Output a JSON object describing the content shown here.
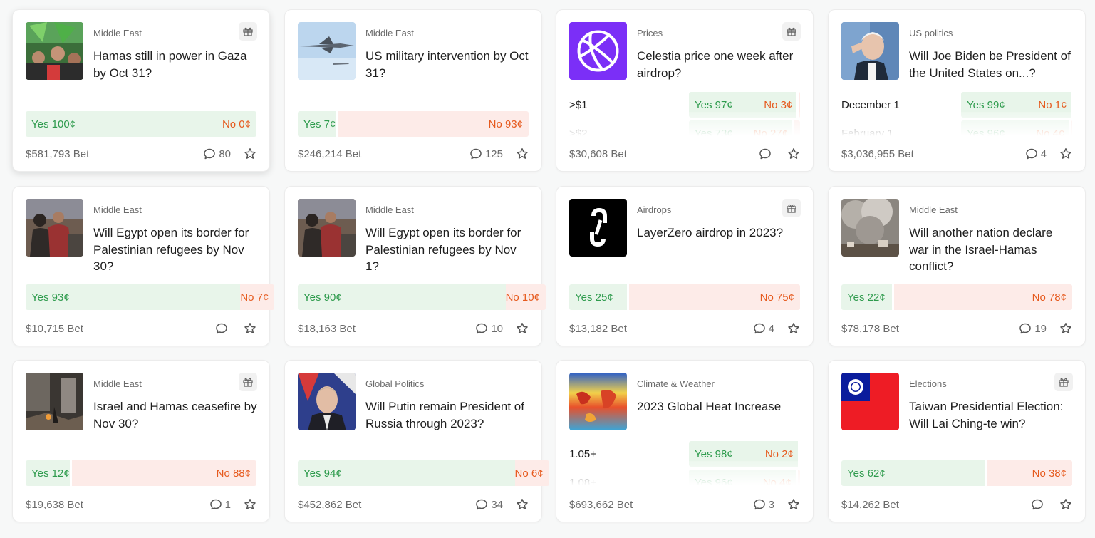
{
  "colors": {
    "yes": "#2e9b4d",
    "no": "#e65a1e",
    "yes_bg": "#e8f5ea",
    "no_bg": "#fdebe8"
  },
  "icons": {
    "gift": "gift-icon",
    "comment": "comment-icon",
    "star": "star-icon"
  },
  "cards": [
    {
      "category": "Middle East",
      "title": "Hamas still in power in Gaza by Oct 31?",
      "yes_label": "Yes 100¢",
      "no_label": "No 0¢",
      "yes_pct": 100,
      "volume": "$581,793 Bet",
      "comments": "80",
      "gift": true,
      "image": "crowd-green-flags"
    },
    {
      "category": "Middle East",
      "title": "US military intervention by Oct 31?",
      "yes_label": "Yes 7¢",
      "no_label": "No 93¢",
      "yes_pct": 7,
      "volume": "$246,214 Bet",
      "comments": "125",
      "gift": false,
      "image": "fighter-jet"
    },
    {
      "category": "Prices",
      "title": "Celestia price one week after airdrop?",
      "volume": "$30,608 Bet",
      "comments": "",
      "gift": true,
      "image": "celestia-logo",
      "outcomes": [
        {
          "label": ">$1",
          "yes": "Yes 97¢",
          "no": "No 3¢",
          "yes_pct": 97
        },
        {
          "label": ">$2",
          "yes": "Yes 73¢",
          "no": "No 27¢",
          "yes_pct": 93
        }
      ]
    },
    {
      "category": "US politics",
      "title": "Will Joe Biden be President of the United States on...?",
      "volume": "$3,036,955 Bet",
      "comments": "4",
      "gift": false,
      "image": "biden-portrait",
      "outcomes": [
        {
          "label": "December 1",
          "yes": "Yes 99¢",
          "no": "No 1¢",
          "yes_pct": 99
        },
        {
          "label": "February 1",
          "yes": "Yes 96¢",
          "no": "No 4¢",
          "yes_pct": 97
        }
      ]
    },
    {
      "category": "Middle East",
      "title": "Will Egypt open its border for Palestinian refugees by Nov 30?",
      "yes_label": "Yes 93¢",
      "no_label": "No 7¢",
      "yes_pct": 93,
      "volume": "$10,715 Bet",
      "comments": "",
      "gift": false,
      "image": "refugees"
    },
    {
      "category": "Middle East",
      "title": "Will Egypt open its border for Palestinian refugees by Nov 1?",
      "yes_label": "Yes 90¢",
      "no_label": "No 10¢",
      "yes_pct": 90,
      "volume": "$18,163 Bet",
      "comments": "10",
      "gift": false,
      "image": "refugees"
    },
    {
      "category": "Airdrops",
      "title": "LayerZero airdrop in 2023?",
      "yes_label": "Yes 25¢",
      "no_label": "No 75¢",
      "yes_pct": 25,
      "volume": "$13,182 Bet",
      "comments": "4",
      "gift": true,
      "image": "layerzero-logo"
    },
    {
      "category": "Middle East",
      "title": "Will another nation declare war in the Israel-Hamas conflict?",
      "yes_label": "Yes 22¢",
      "no_label": "No 78¢",
      "yes_pct": 22,
      "volume": "$78,178 Bet",
      "comments": "19",
      "gift": false,
      "image": "smoke-city"
    },
    {
      "category": "Middle East",
      "title": "Israel and Hamas ceasefire by Nov 30?",
      "yes_label": "Yes 12¢",
      "no_label": "No 88¢",
      "yes_pct": 12,
      "volume": "$19,638 Bet",
      "comments": "1",
      "gift": true,
      "image": "rubble"
    },
    {
      "category": "Global Politics",
      "title": "Will Putin remain President of Russia through 2023?",
      "yes_label": "Yes 94¢",
      "no_label": "No 6¢",
      "yes_pct": 94,
      "volume": "$452,862 Bet",
      "comments": "34",
      "gift": false,
      "image": "putin-portrait"
    },
    {
      "category": "Climate & Weather",
      "title": "2023 Global Heat Increase",
      "volume": "$693,662 Bet",
      "comments": "3",
      "gift": false,
      "image": "heat-map",
      "outcomes": [
        {
          "label": "1.05+",
          "yes": "Yes 98¢",
          "no": "No 2¢",
          "yes_pct": 98
        },
        {
          "label": "1.08+",
          "yes": "Yes 96¢",
          "no": "No 4¢",
          "yes_pct": 96
        }
      ]
    },
    {
      "category": "Elections",
      "title": "Taiwan Presidential Election: Will Lai Ching-te win?",
      "yes_label": "Yes 62¢",
      "no_label": "No 38¢",
      "yes_pct": 62,
      "volume": "$14,262 Bet",
      "comments": "",
      "gift": true,
      "image": "taiwan-flag"
    }
  ]
}
